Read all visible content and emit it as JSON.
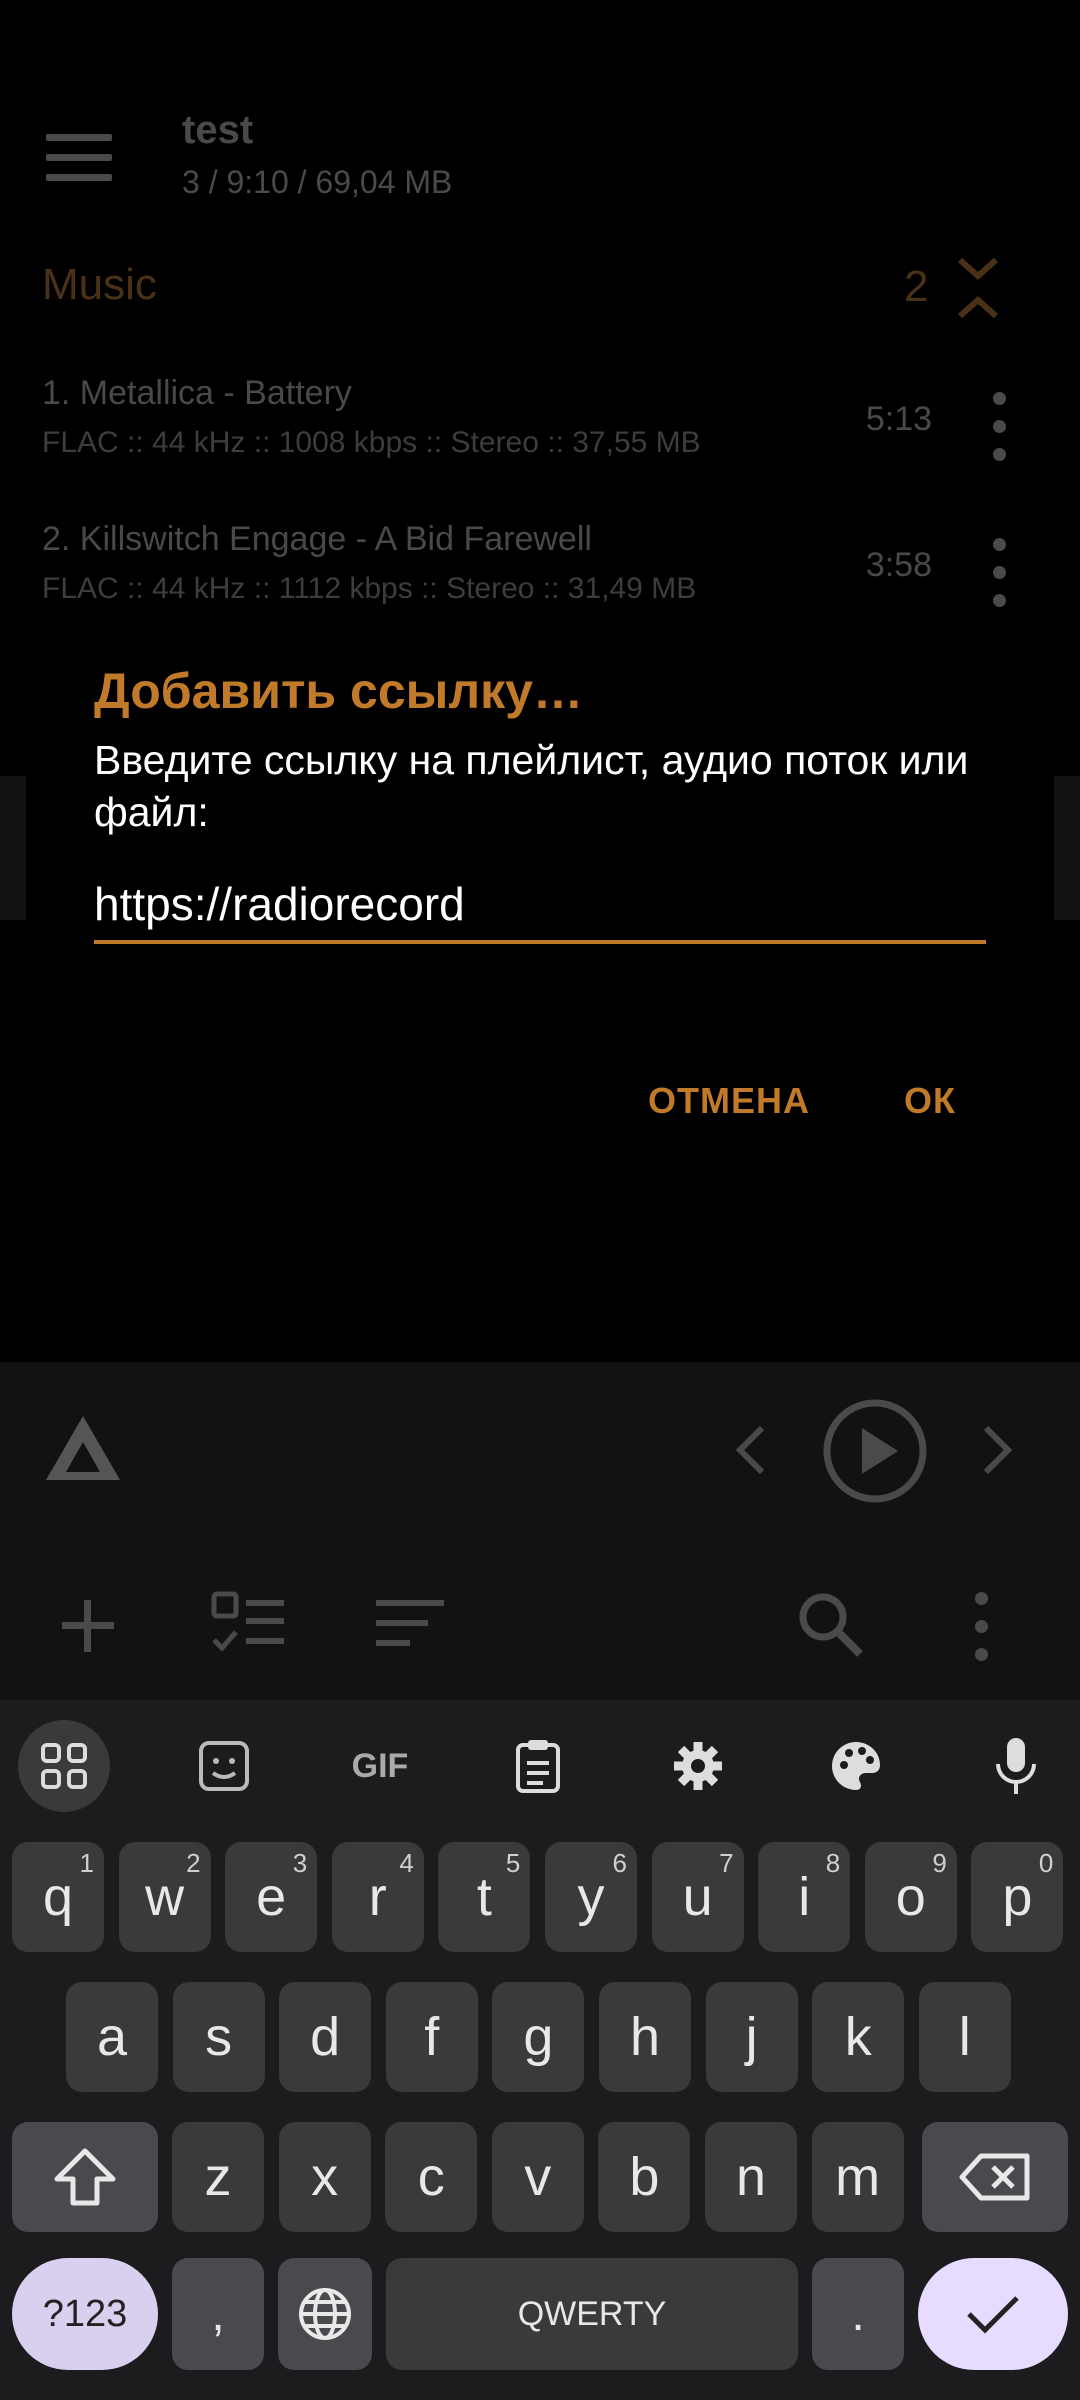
{
  "header": {
    "title": "test",
    "subtitle": "3 / 9:10 / 69,04 MB"
  },
  "playlist": {
    "section_title": "Music",
    "section_count": "2",
    "tracks": [
      {
        "name": "1. Metallica - Battery",
        "meta": "FLAC :: 44 kHz :: 1008 kbps :: Stereo :: 37,55 MB",
        "duration": "5:13"
      },
      {
        "name": "2. Killswitch Engage - A Bid Farewell",
        "meta": "FLAC :: 44 kHz :: 1112 kbps :: Stereo :: 31,49 MB",
        "duration": "3:58"
      }
    ]
  },
  "dialog": {
    "title": "Добавить ссылку…",
    "message": "Введите ссылку на плейлист, аудио поток или файл:",
    "input_value": "https://radiorecord",
    "cancel_label": "ОТМЕНА",
    "ok_label": "ОК"
  },
  "keyboard": {
    "row1": [
      [
        "q",
        "1"
      ],
      [
        "w",
        "2"
      ],
      [
        "e",
        "3"
      ],
      [
        "r",
        "4"
      ],
      [
        "t",
        "5"
      ],
      [
        "y",
        "6"
      ],
      [
        "u",
        "7"
      ],
      [
        "i",
        "8"
      ],
      [
        "o",
        "9"
      ],
      [
        "p",
        "0"
      ]
    ],
    "row2": [
      "a",
      "s",
      "d",
      "f",
      "g",
      "h",
      "j",
      "k",
      "l"
    ],
    "row3": [
      "z",
      "x",
      "c",
      "v",
      "b",
      "n",
      "m"
    ],
    "symbols_label": "?123",
    "comma_label": ",",
    "space_label": "QWERTY",
    "period_label": ".",
    "gif_label": "GIF"
  },
  "colors": {
    "accent": "#c07a2a",
    "keyboard_bg": "#1c1c1e",
    "key_bg": "#3a3a3c",
    "enter_bg": "#e7dcff"
  }
}
